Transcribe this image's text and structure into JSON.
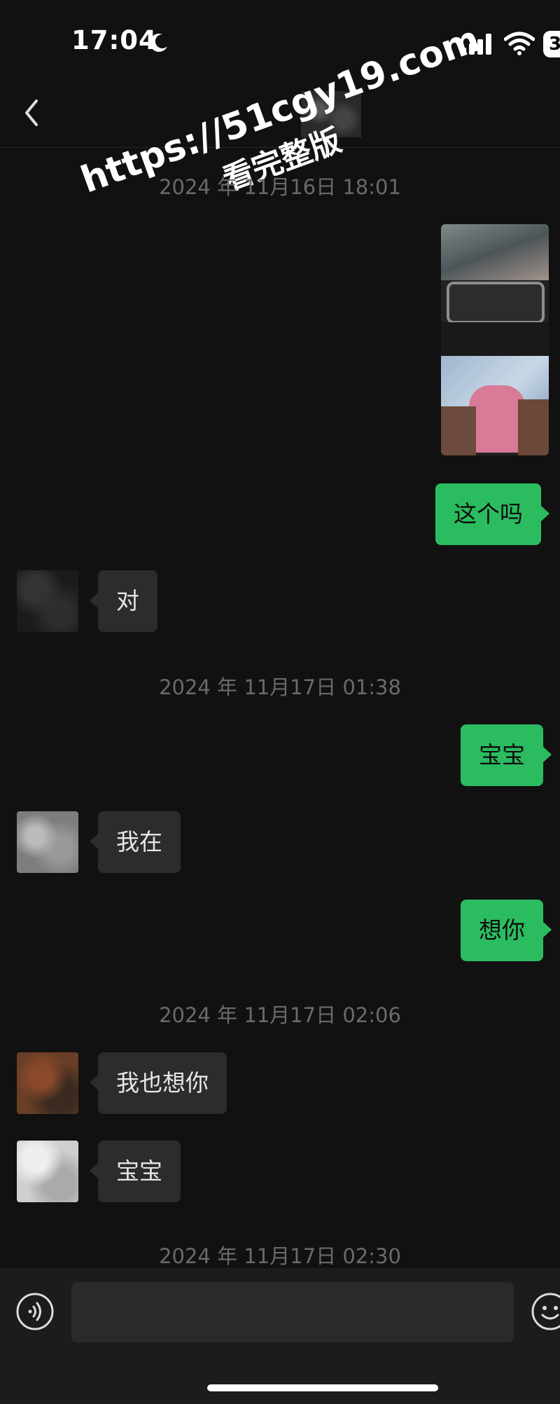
{
  "status_bar": {
    "time": "17:04",
    "battery": "3"
  },
  "nav": {
    "back_icon": "chevron-left-icon"
  },
  "watermark": {
    "line1": "https://51cgy19.com",
    "line2": "看完整版"
  },
  "messages": {
    "ts1": "2024 年 11月16日 18:01",
    "m1": "这个吗",
    "m2": "对",
    "ts2": "2024 年 11月17日 01:38",
    "m3": "宝宝",
    "m4": "我在",
    "m5": "想你",
    "ts3": "2024 年 11月17日 02:06",
    "m6": "我也想你",
    "m7": "宝宝",
    "ts4": "2024 年 11月17日 02:30"
  },
  "input_bar": {
    "value": "",
    "voice_icon": "voice-icon",
    "emoji_icon": "emoji-icon"
  },
  "colors": {
    "background": "#111111",
    "outgoing_bubble": "#2bbc60",
    "incoming_bubble": "#2c2c2c"
  }
}
